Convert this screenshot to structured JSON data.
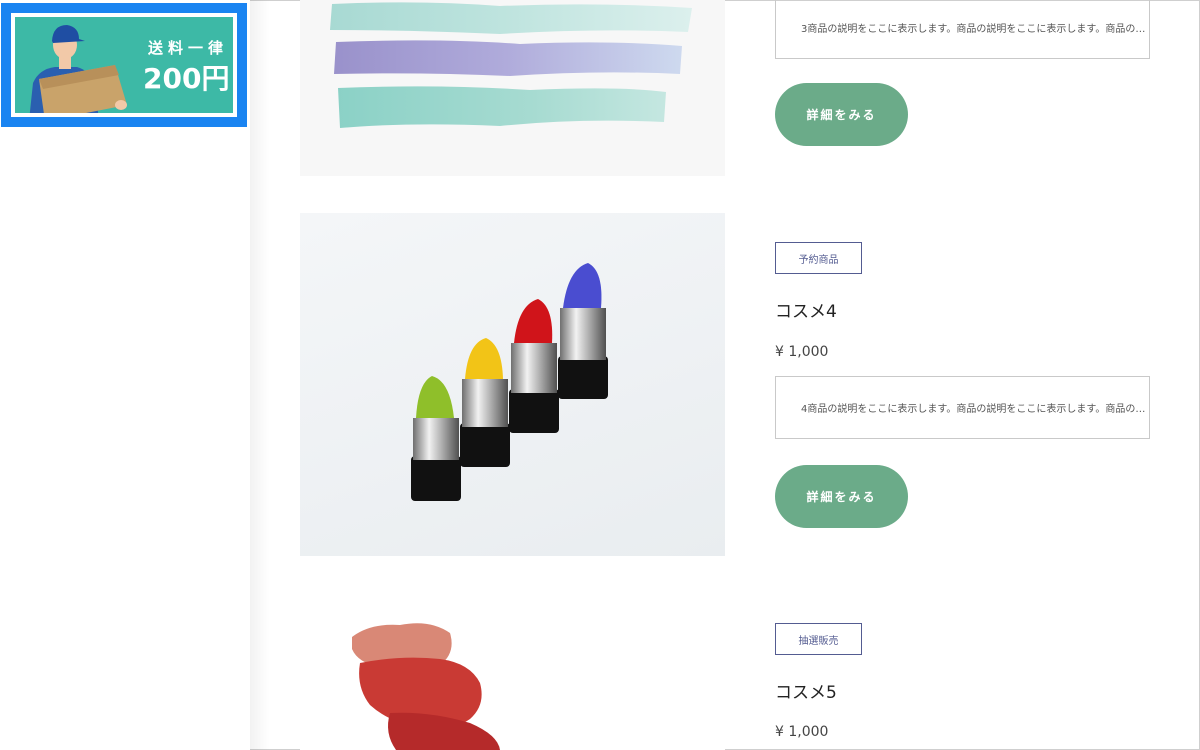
{
  "banner": {
    "line1": "送料一律",
    "line2": "200円"
  },
  "products": [
    {
      "description": "3商品の説明をここに表示します。商品の説明をここに表示します。商品の…",
      "button_label": "詳細をみる"
    },
    {
      "tag": "予約商品",
      "name": "コスメ4",
      "price": "¥ 1,000",
      "description": "4商品の説明をここに表示します。商品の説明をここに表示します。商品の…",
      "button_label": "詳細をみる"
    },
    {
      "tag": "抽選販売",
      "name": "コスメ5",
      "price": "¥ 1,000"
    }
  ],
  "colors": {
    "banner_border": "#1a84f1",
    "banner_bg": "#3db9a6",
    "button": "#6bab89",
    "tag_border": "#545c91"
  }
}
